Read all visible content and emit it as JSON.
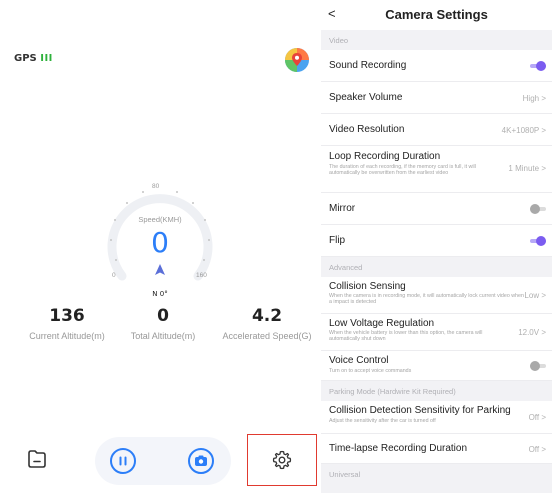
{
  "dashboard": {
    "gps_label": "GPS",
    "gps_bars": "III",
    "speed_label": "Speed(KMH)",
    "speed_value": "0",
    "tick_min": "0",
    "tick_mid": "80",
    "tick_max": "160",
    "heading": "N 0°",
    "stats": [
      {
        "value": "136",
        "label": "Current Altitude(m)"
      },
      {
        "value": "0",
        "label": "Total Altitude(m)"
      },
      {
        "value": "4.2",
        "label": "Accelerated Speed(G)"
      }
    ]
  },
  "settings": {
    "title": "Camera Settings",
    "back": "<",
    "video_section": "Video",
    "sound_recording": "Sound Recording",
    "speaker_volume": "Speaker Volume",
    "speaker_volume_value": "High >",
    "video_resolution": "Video Resolution",
    "video_resolution_value": "4K+1080P >",
    "loop_recording": "Loop Recording Duration",
    "loop_recording_desc": "The duration of each recording, if the memory card is full, it will automatically be overwritten from the earliest video",
    "loop_recording_value": "1 Minute >",
    "mirror": "Mirror",
    "flip": "Flip",
    "advanced_section": "Advanced",
    "collision_sensing": "Collision Sensing",
    "collision_sensing_desc": "When the camera is in recording mode, it will automatically lock current video when a impact is detected",
    "collision_sensing_value": "Low >",
    "low_voltage": "Low Voltage Regulation",
    "low_voltage_desc": "When the vehicle battery is lower than this option, the camera will automatically shut down",
    "low_voltage_value": "12.0V >",
    "voice_control": "Voice Control",
    "voice_control_desc": "Turn on to accept voice commands",
    "parking_section": "Parking Mode (Hardwire Kit Required)",
    "collision_parking": "Collision Detection Sensitivity for Parking",
    "collision_parking_desc": "Adjust the sensitivity after the car is turned off",
    "collision_parking_value": "Off >",
    "timelapse": "Time-lapse Recording Duration",
    "timelapse_value": "Off >",
    "universal_section": "Universal"
  },
  "colors": {
    "accent": "#2c7ef8",
    "toggle_on": "#7b5cf0",
    "gps_green": "#2db13b",
    "highlight_border": "#e03a2f"
  }
}
